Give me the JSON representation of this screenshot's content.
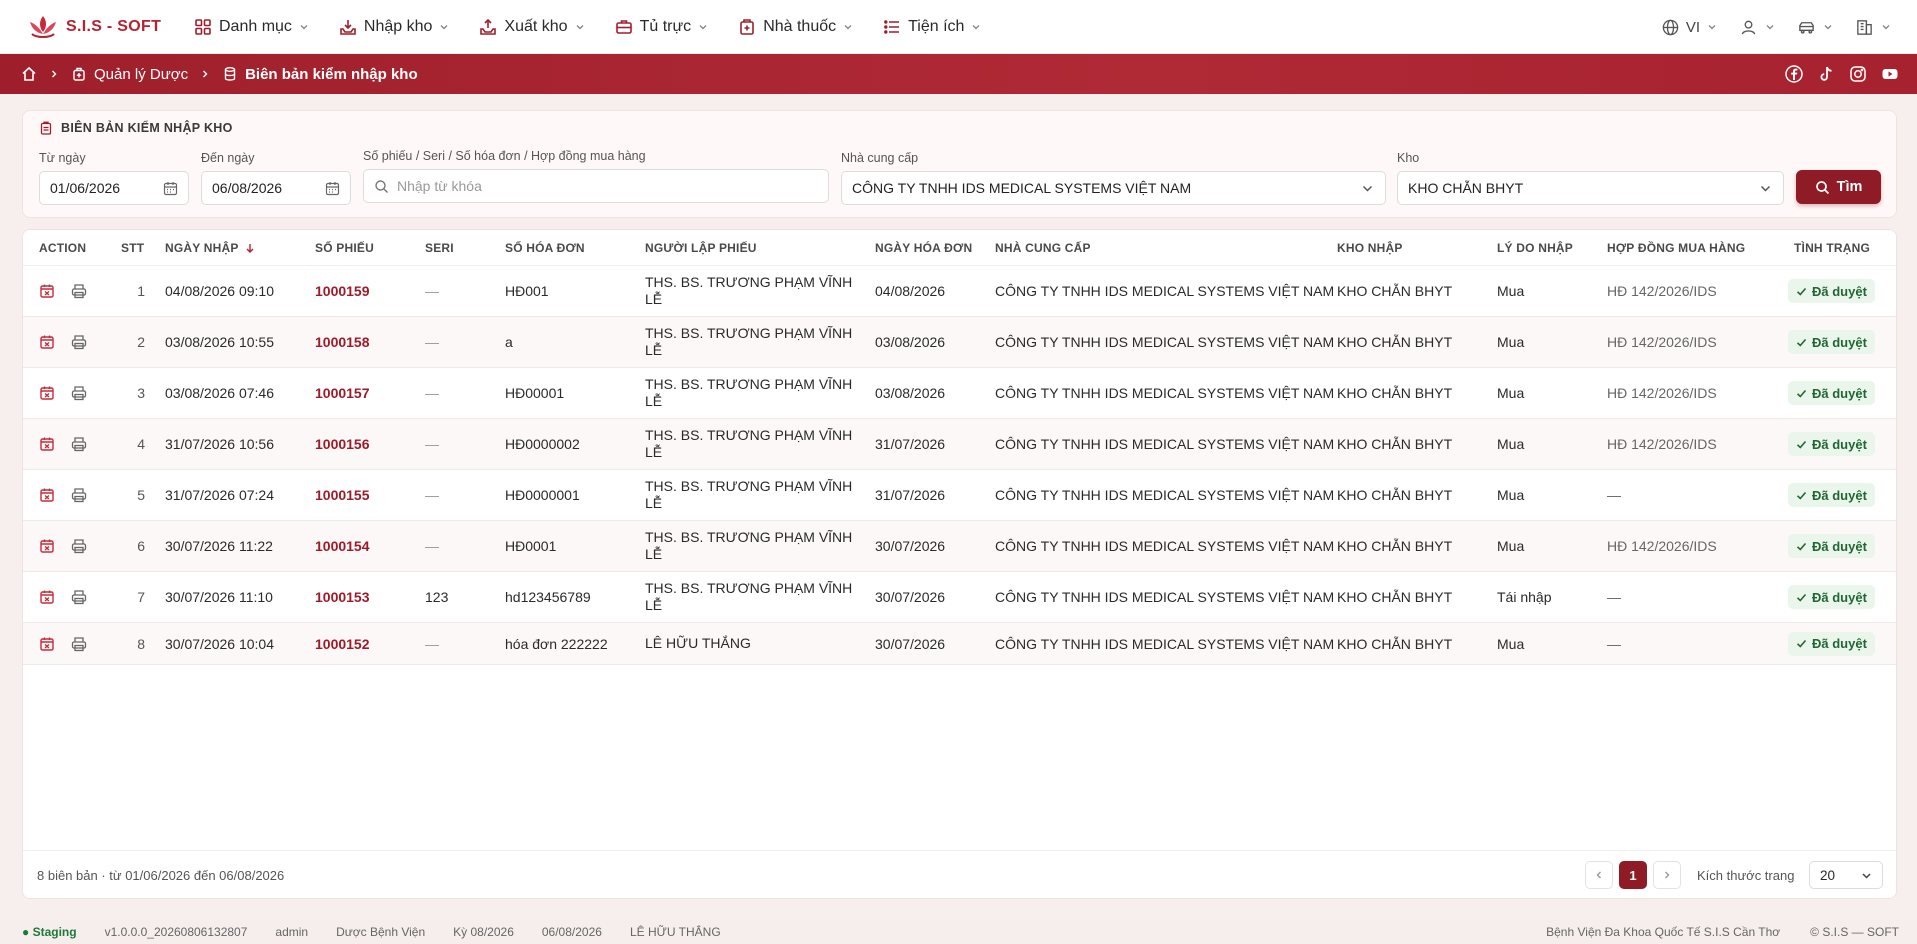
{
  "app": {
    "logo_text": "S.I.S - SOFT"
  },
  "nav": {
    "menu": [
      {
        "label": "Danh mục",
        "icon": "grid-icon"
      },
      {
        "label": "Nhập kho",
        "icon": "inbox-download-icon"
      },
      {
        "label": "Xuất kho",
        "icon": "inbox-upload-icon"
      },
      {
        "label": "Tủ trực",
        "icon": "briefcase-icon"
      },
      {
        "label": "Nhà thuốc",
        "icon": "pharmacy-icon"
      },
      {
        "label": "Tiện ích",
        "icon": "list-icon"
      }
    ],
    "language": "VI"
  },
  "breadcrumb": {
    "parent": "Quản lý Dược",
    "current": "Biên bản kiểm nhập kho"
  },
  "filter": {
    "title": "BIÊN BẢN KIỂM NHẬP KHO",
    "from_label": "Từ ngày",
    "from_value": "01/06/2026",
    "to_label": "Đến ngày",
    "to_value": "06/08/2026",
    "keyword_label": "Số phiếu / Seri / Số hóa đơn / Hợp đồng mua hàng",
    "keyword_placeholder": "Nhập từ khóa",
    "supplier_label": "Nhà cung cấp",
    "supplier_value": "CÔNG TY TNHH IDS MEDICAL SYSTEMS VIỆT NAM",
    "warehouse_label": "Kho",
    "warehouse_value": "KHO CHẴN BHYT",
    "search_label": "Tìm"
  },
  "table": {
    "columns": {
      "action": "ACTION",
      "stt": "STT",
      "date": "NGÀY NHẬP",
      "ticket": "SỐ PHIẾU",
      "seri": "SERI",
      "invoice": "SỐ HÓA ĐƠN",
      "creator": "NGƯỜI LẬP PHIẾU",
      "invoice_date": "NGÀY HÓA ĐƠN",
      "supplier": "NHÀ CUNG CẤP",
      "warehouse": "KHO NHẬP",
      "reason": "LÝ DO NHẬP",
      "contract": "HỢP ĐỒNG MUA HÀNG",
      "status": "TÌNH TRẠNG"
    },
    "rows": [
      {
        "stt": "1",
        "date": "04/08/2026 09:10",
        "ticket": "1000159",
        "seri": "—",
        "invoice": "HĐ001",
        "creator": "THS. BS. TRƯƠNG PHẠM VĨNH LỄ",
        "invoice_date": "04/08/2026",
        "supplier": "CÔNG TY TNHH IDS MEDICAL SYSTEMS VIỆT NAM",
        "warehouse": "KHO CHẴN BHYT",
        "reason": "Mua",
        "contract": "HĐ 142/2026/IDS",
        "status": "Đã duyệt"
      },
      {
        "stt": "2",
        "date": "03/08/2026 10:55",
        "ticket": "1000158",
        "seri": "—",
        "invoice": "a",
        "creator": "THS. BS. TRƯƠNG PHẠM VĨNH LỄ",
        "invoice_date": "03/08/2026",
        "supplier": "CÔNG TY TNHH IDS MEDICAL SYSTEMS VIỆT NAM",
        "warehouse": "KHO CHẴN BHYT",
        "reason": "Mua",
        "contract": "HĐ 142/2026/IDS",
        "status": "Đã duyệt"
      },
      {
        "stt": "3",
        "date": "03/08/2026 07:46",
        "ticket": "1000157",
        "seri": "—",
        "invoice": "HĐ00001",
        "creator": "THS. BS. TRƯƠNG PHẠM VĨNH LỄ",
        "invoice_date": "03/08/2026",
        "supplier": "CÔNG TY TNHH IDS MEDICAL SYSTEMS VIỆT NAM",
        "warehouse": "KHO CHẴN BHYT",
        "reason": "Mua",
        "contract": "HĐ 142/2026/IDS",
        "status": "Đã duyệt"
      },
      {
        "stt": "4",
        "date": "31/07/2026 10:56",
        "ticket": "1000156",
        "seri": "—",
        "invoice": "HĐ0000002",
        "creator": "THS. BS. TRƯƠNG PHẠM VĨNH LỄ",
        "invoice_date": "31/07/2026",
        "supplier": "CÔNG TY TNHH IDS MEDICAL SYSTEMS VIỆT NAM",
        "warehouse": "KHO CHẴN BHYT",
        "reason": "Mua",
        "contract": "HĐ 142/2026/IDS",
        "status": "Đã duyệt"
      },
      {
        "stt": "5",
        "date": "31/07/2026 07:24",
        "ticket": "1000155",
        "seri": "—",
        "invoice": "HĐ0000001",
        "creator": "THS. BS. TRƯƠNG PHẠM VĨNH LỄ",
        "invoice_date": "31/07/2026",
        "supplier": "CÔNG TY TNHH IDS MEDICAL SYSTEMS VIỆT NAM",
        "warehouse": "KHO CHẴN BHYT",
        "reason": "Mua",
        "contract": "—",
        "status": "Đã duyệt"
      },
      {
        "stt": "6",
        "date": "30/07/2026 11:22",
        "ticket": "1000154",
        "seri": "—",
        "invoice": "HĐ0001",
        "creator": "THS. BS. TRƯƠNG PHẠM VĨNH LỄ",
        "invoice_date": "30/07/2026",
        "supplier": "CÔNG TY TNHH IDS MEDICAL SYSTEMS VIỆT NAM",
        "warehouse": "KHO CHẴN BHYT",
        "reason": "Mua",
        "contract": "HĐ 142/2026/IDS",
        "status": "Đã duyệt"
      },
      {
        "stt": "7",
        "date": "30/07/2026 11:10",
        "ticket": "1000153",
        "seri": "123",
        "invoice": "hd123456789",
        "creator": "THS. BS. TRƯƠNG PHẠM VĨNH LỄ",
        "invoice_date": "30/07/2026",
        "supplier": "CÔNG TY TNHH IDS MEDICAL SYSTEMS VIỆT NAM",
        "warehouse": "KHO CHẴN BHYT",
        "reason": "Tái nhập",
        "contract": "—",
        "status": "Đã duyệt"
      },
      {
        "stt": "8",
        "date": "30/07/2026 10:04",
        "ticket": "1000152",
        "seri": "—",
        "invoice": "hóa đơn 222222",
        "creator": "LÊ HỮU THẮNG",
        "invoice_date": "30/07/2026",
        "supplier": "CÔNG TY TNHH IDS MEDICAL SYSTEMS VIỆT NAM",
        "warehouse": "KHO CHẴN BHYT",
        "reason": "Mua",
        "contract": "—",
        "status": "Đã duyệt"
      }
    ],
    "footer_info": "8 biên bản · từ 01/06/2026 đến 06/08/2026",
    "current_page": "1",
    "page_size_label": "Kích thước trang",
    "page_size": "20"
  },
  "statusbar": {
    "env": "● Staging",
    "version": "v1.0.0.0_20260806132807",
    "user": "admin",
    "department": "Dược Bệnh Viện",
    "period": "Kỳ 08/2026",
    "date": "06/08/2026",
    "person": "LÊ HỮU THẮNG",
    "hospital": "Bệnh Viện Đa Khoa Quốc Tế S.I.S Cần Thơ",
    "copyright": "© S.I.S — SOFT"
  },
  "colors": {
    "brand": "#9e1f2b",
    "ticket": "#9b1c28",
    "approved_bg": "#eaf6ec",
    "approved_text": "#226633"
  }
}
